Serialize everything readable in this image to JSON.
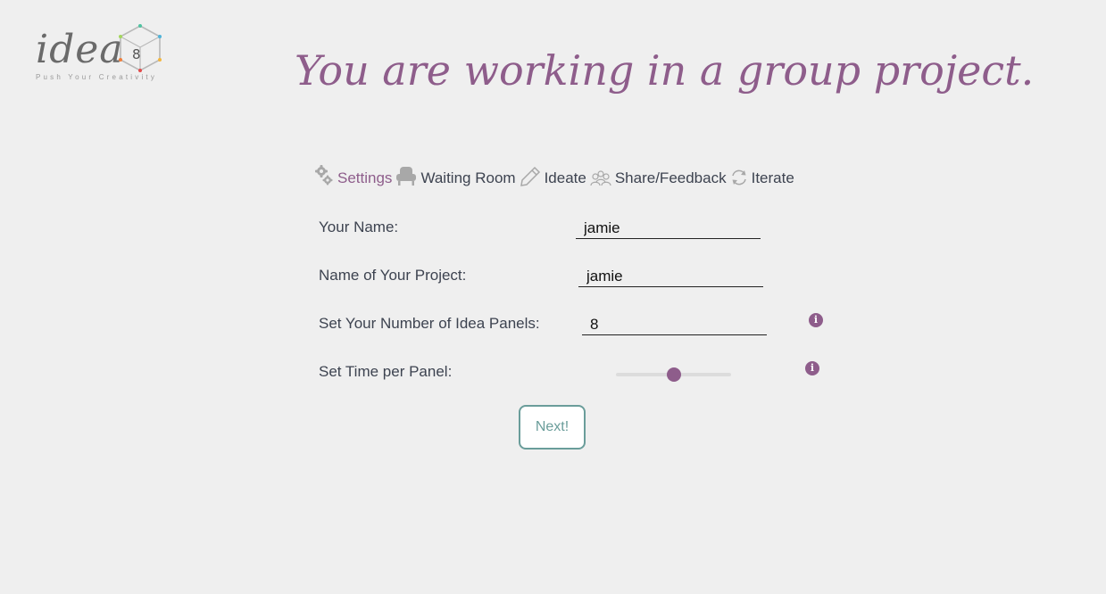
{
  "logo": {
    "word": "idea",
    "cube_number": "8",
    "tagline": "Push Your Creativity"
  },
  "title": "You are working in a group project.",
  "steps": [
    {
      "label": "Settings",
      "icon": "gears-icon",
      "active": true
    },
    {
      "label": "Waiting Room",
      "icon": "armchair-icon",
      "active": false
    },
    {
      "label": "Ideate",
      "icon": "pencil-icon",
      "active": false
    },
    {
      "label": "Share/Feedback",
      "icon": "group-icon",
      "active": false
    },
    {
      "label": "Iterate",
      "icon": "refresh-icon",
      "active": false
    }
  ],
  "form": {
    "name_label": "Your Name:",
    "name_value": "jamie",
    "project_label": "Name of Your Project:",
    "project_value": "jamie",
    "panels_label": "Set Your Number of Idea Panels:",
    "panels_value": "8",
    "time_label": "Set Time per Panel:",
    "time_slider_fraction": 0.5,
    "info_glyph": "i"
  },
  "next_button": "Next!",
  "colors": {
    "accent": "#8e5d8b",
    "button_border": "#6a9d9a",
    "background": "#efefef",
    "text": "#3d4350"
  }
}
